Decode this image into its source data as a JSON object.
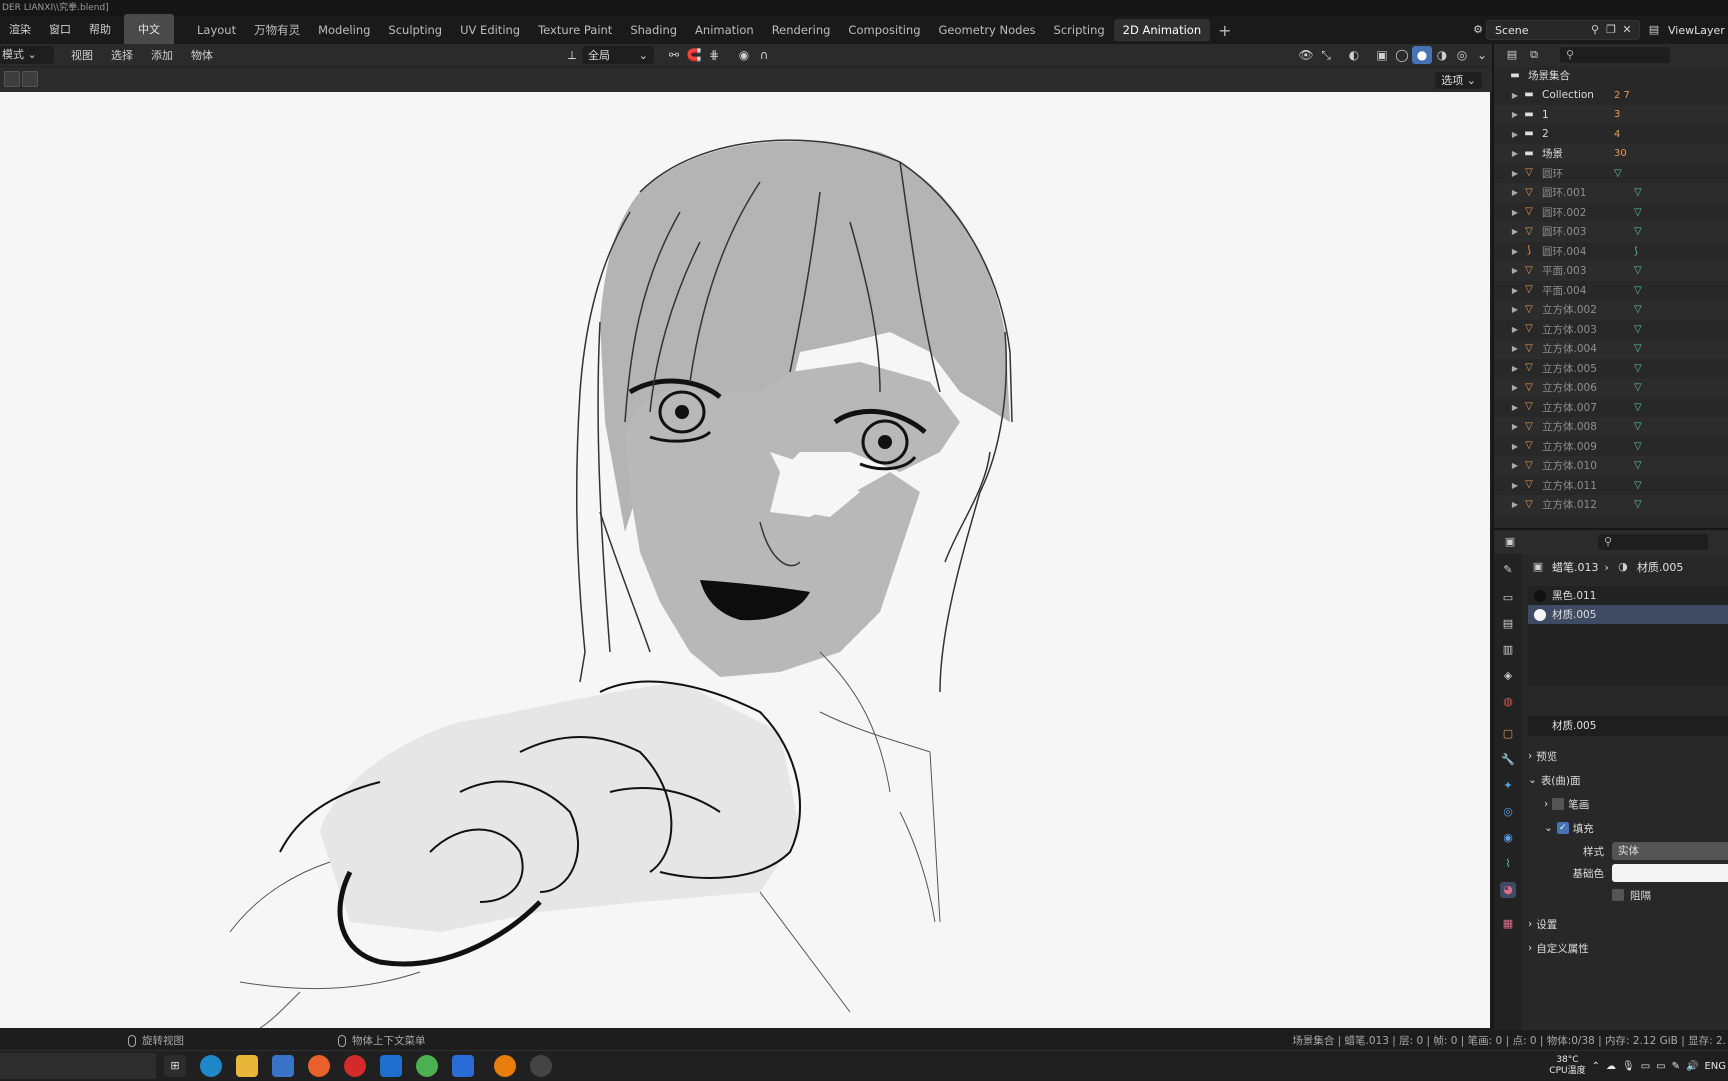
{
  "window": {
    "title": "DER LIANXI\\\\究拳.blend]"
  },
  "menu": [
    "渲染",
    "窗口",
    "帮助"
  ],
  "language_button": "中文",
  "workspace_tabs": [
    {
      "label": "Layout",
      "active": false
    },
    {
      "label": "万物有灵",
      "active": false
    },
    {
      "label": "Modeling",
      "active": false
    },
    {
      "label": "Sculpting",
      "active": false
    },
    {
      "label": "UV Editing",
      "active": false
    },
    {
      "label": "Texture Paint",
      "active": false
    },
    {
      "label": "Shading",
      "active": false
    },
    {
      "label": "Animation",
      "active": false
    },
    {
      "label": "Rendering",
      "active": false
    },
    {
      "label": "Compositing",
      "active": false
    },
    {
      "label": "Geometry Nodes",
      "active": false
    },
    {
      "label": "Scripting",
      "active": false
    },
    {
      "label": "2D Animation",
      "active": true
    }
  ],
  "tab_add": "+",
  "scene": {
    "name": "Scene",
    "view_layer": "ViewLayer"
  },
  "viewport_header": {
    "mode": "模式",
    "menus": [
      "视图",
      "选择",
      "添加",
      "物体"
    ],
    "transform_orientation": "全局",
    "options_button": "选项"
  },
  "outliner": {
    "root": "场景集合",
    "rows": [
      {
        "label": "Collection",
        "type": "collection",
        "extra": "2 7"
      },
      {
        "label": "1",
        "type": "collection",
        "extra": "3"
      },
      {
        "label": "2",
        "type": "collection",
        "extra": "4"
      },
      {
        "label": "场景",
        "type": "collection",
        "extra": "30"
      },
      {
        "label": "圆环",
        "type": "mesh"
      },
      {
        "label": "圆环.001",
        "type": "mesh"
      },
      {
        "label": "圆环.002",
        "type": "mesh"
      },
      {
        "label": "圆环.003",
        "type": "mesh"
      },
      {
        "label": "圆环.004",
        "type": "curve"
      },
      {
        "label": "平面.003",
        "type": "mesh"
      },
      {
        "label": "平面.004",
        "type": "mesh"
      },
      {
        "label": "立方体.002",
        "type": "mesh"
      },
      {
        "label": "立方体.003",
        "type": "mesh"
      },
      {
        "label": "立方体.004",
        "type": "mesh"
      },
      {
        "label": "立方体.005",
        "type": "mesh"
      },
      {
        "label": "立方体.006",
        "type": "mesh"
      },
      {
        "label": "立方体.007",
        "type": "mesh"
      },
      {
        "label": "立方体.008",
        "type": "mesh"
      },
      {
        "label": "立方体.009",
        "type": "mesh"
      },
      {
        "label": "立方体.010",
        "type": "mesh"
      },
      {
        "label": "立方体.011",
        "type": "mesh"
      },
      {
        "label": "立方体.012",
        "type": "mesh"
      }
    ]
  },
  "properties": {
    "object": "蜡笔.013",
    "material": "材质.005",
    "material_slots": [
      "黑色.011",
      "材质.005"
    ],
    "material_name_field": "材质.005",
    "panels": {
      "preview": "预览",
      "surface": "表(曲)面",
      "stroke": "笔画",
      "fill": "填充",
      "style_label": "样式",
      "style_value": "实体",
      "base_color_label": "基础色",
      "holdout_label": "阻隔",
      "settings": "设置",
      "custom_props": "自定义属性"
    },
    "fill_checked": true,
    "stroke_checked": false,
    "holdout_checked": false
  },
  "status_bar": {
    "left_hint": "旋转视图",
    "mid_hint": "物体上下文菜单",
    "stats": "场景集合 | 蜡笔.013 | 层: 0 | 帧: 0 | 笔画: 0 | 点: 0 | 物体:0/38 | 内存: 2.12 GiB | 显存: 2."
  },
  "taskbar": {
    "weather_temp": "38°C",
    "weather_label": "CPU温度",
    "language": "ENG"
  },
  "colors": {
    "accent": "#4772b3",
    "active_tab_bg": "#303030",
    "canvas_bg": "#f6f6f6",
    "collection_icon": "#e29b54",
    "mesh_icon": "#5bc49a"
  }
}
